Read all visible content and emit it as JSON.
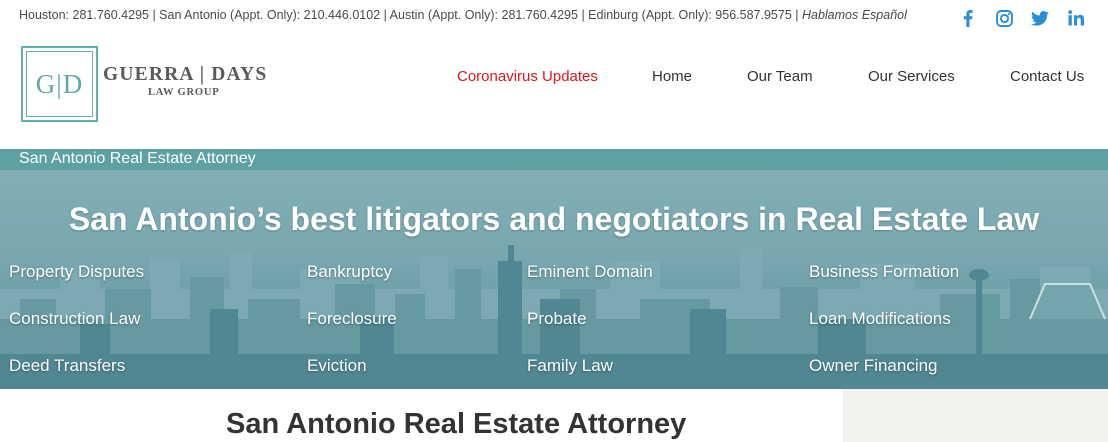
{
  "topbar": {
    "contact_text": "Houston: 281.760.4295 | San Antonio (Appt. Only): 210.446.0102 | Austin (Appt. Only): 281.760.4295 | Edinburg (Appt. Only): 956.587.9575 | ",
    "tagline": "Hablamos Español",
    "social_color": "#2a8fd4",
    "social": [
      {
        "icon": "facebook-icon"
      },
      {
        "icon": "instagram-icon"
      },
      {
        "icon": "twitter-icon"
      },
      {
        "icon": "linkedin-icon"
      }
    ]
  },
  "logo": {
    "initials": "G|D",
    "name": "GUERRA | DAYS",
    "subtitle": "LAW GROUP",
    "color": "#62b0ae"
  },
  "nav": {
    "items": [
      {
        "label": "Coronavirus Updates",
        "color": "#d7191c"
      },
      {
        "label": "Home"
      },
      {
        "label": "Our Team"
      },
      {
        "label": "Our Services"
      },
      {
        "label": "Contact Us"
      }
    ]
  },
  "hero": {
    "strip_label": "San Antonio Real Estate Attorney",
    "title": "San Antonio’s best litigators and negotiators in Real Estate Law",
    "tint_color": "#5aa0a0",
    "services": [
      "Property Disputes",
      "Bankruptcy",
      "Eminent Domain",
      "Business Formation",
      "Construction Law",
      "Foreclosure",
      "Probate",
      "Loan Modifications",
      "Deed Transfers",
      "Eviction",
      "Family Law",
      "Owner Financing"
    ]
  },
  "main": {
    "page_title": "San Antonio Real Estate Attorney"
  }
}
